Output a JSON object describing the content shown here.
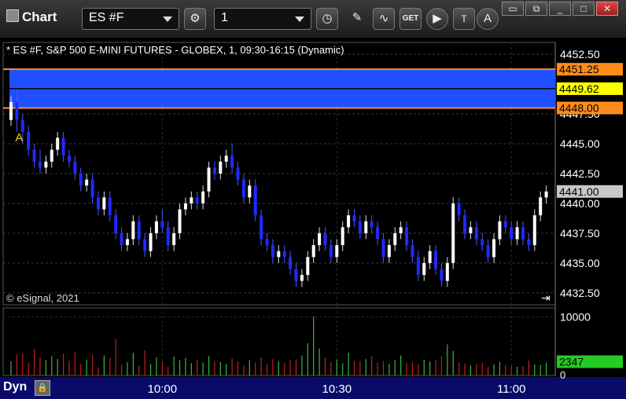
{
  "window": {
    "title": "Chart"
  },
  "toolbar": {
    "symbol": "ES #F",
    "interval": "1"
  },
  "chart": {
    "header": "* ES #F, S&P 500 E-MINI FUTURES - GLOBEX, 1, 09:30-16:15 (Dynamic)",
    "copyright": "© eSignal, 2021",
    "marker": "A",
    "price_labels": [
      "4452.50",
      "4447.50",
      "4445.00",
      "4442.50",
      "4440.00",
      "4437.50",
      "4435.00",
      "4432.50"
    ],
    "volume_labels": [
      "10000",
      "0"
    ],
    "time_labels": [
      "10:00",
      "10:30",
      "11:00"
    ],
    "tags": {
      "upper_band": "4451.25",
      "last": "4449.62",
      "lower_band": "4448.00",
      "cursor": "4441.00",
      "volume": "2347"
    },
    "footer": "Dyn"
  },
  "colors": {
    "band": "#1f50ff",
    "band_border": "#ff8a3a",
    "up_candle": "#ffffff",
    "down_candle": "#1f2aff",
    "vol_up": "#3cb83c",
    "vol_down": "#c02020",
    "last_tag": "#ffff00",
    "band_tag": "#ff8c1a",
    "volume_tag": "#22cc22"
  },
  "chart_data": {
    "type": "candlestick",
    "y_range": [
      4431.5,
      4453.5
    ],
    "volume_range": [
      0,
      11000
    ],
    "bars": [
      [
        4447.0,
        4448.5,
        4449.0,
        4446.5
      ],
      [
        4448.5,
        4447.0,
        4449.5,
        4446.0
      ],
      [
        4447.0,
        4446.0,
        4447.5,
        4445.0
      ],
      [
        4446.0,
        4444.5,
        4446.5,
        4444.0
      ],
      [
        4444.5,
        4443.5,
        4445.0,
        4443.0
      ],
      [
        4443.5,
        4443.0,
        4444.5,
        4442.5
      ],
      [
        4443.0,
        4443.5,
        4444.0,
        4442.5
      ],
      [
        4443.5,
        4444.5,
        4445.0,
        4443.0
      ],
      [
        4444.5,
        4445.5,
        4446.0,
        4444.0
      ],
      [
        4445.5,
        4444.0,
        4446.0,
        4443.5
      ],
      [
        4444.0,
        4443.5,
        4444.5,
        4443.0
      ],
      [
        4443.5,
        4442.5,
        4444.0,
        4442.0
      ],
      [
        4442.5,
        4441.5,
        4443.0,
        4441.0
      ],
      [
        4441.5,
        4442.0,
        4442.5,
        4441.0
      ],
      [
        4442.0,
        4440.5,
        4442.5,
        4440.0
      ],
      [
        4440.5,
        4439.5,
        4441.0,
        4439.0
      ],
      [
        4439.5,
        4440.5,
        4441.0,
        4439.0
      ],
      [
        4440.5,
        4439.0,
        4441.0,
        4438.5
      ],
      [
        4439.0,
        4437.5,
        4439.5,
        4437.0
      ],
      [
        4437.5,
        4436.5,
        4438.0,
        4436.0
      ],
      [
        4436.5,
        4437.0,
        4437.5,
        4436.0
      ],
      [
        4437.0,
        4438.5,
        4439.0,
        4436.5
      ],
      [
        4438.5,
        4437.0,
        4439.0,
        4436.5
      ],
      [
        4437.0,
        4436.0,
        4437.5,
        4435.5
      ],
      [
        4436.0,
        4437.5,
        4438.0,
        4435.5
      ],
      [
        4437.5,
        4438.5,
        4439.0,
        4437.0
      ],
      [
        4438.5,
        4438.0,
        4439.5,
        4437.5
      ],
      [
        4438.0,
        4436.5,
        4438.5,
        4436.0
      ],
      [
        4436.5,
        4437.5,
        4438.0,
        4436.0
      ],
      [
        4437.5,
        4439.5,
        4440.0,
        4437.0
      ],
      [
        4439.5,
        4440.0,
        4440.5,
        4439.0
      ],
      [
        4440.0,
        4440.5,
        4441.0,
        4439.5
      ],
      [
        4440.5,
        4440.0,
        4441.0,
        4439.5
      ],
      [
        4440.0,
        4441.0,
        4441.5,
        4439.5
      ],
      [
        4441.0,
        4443.0,
        4443.5,
        4440.5
      ],
      [
        4443.0,
        4442.5,
        4443.5,
        4442.0
      ],
      [
        4442.5,
        4443.5,
        4444.0,
        4442.0
      ],
      [
        4443.5,
        4444.0,
        4444.5,
        4443.0
      ],
      [
        4444.0,
        4443.0,
        4445.0,
        4442.5
      ],
      [
        4443.0,
        4442.0,
        4443.5,
        4441.5
      ],
      [
        4442.0,
        4440.5,
        4442.5,
        4440.0
      ],
      [
        4440.5,
        4441.5,
        4442.0,
        4440.0
      ],
      [
        4441.5,
        4439.0,
        4442.0,
        4438.5
      ],
      [
        4439.0,
        4437.0,
        4439.5,
        4436.5
      ],
      [
        4437.0,
        4436.5,
        4437.5,
        4436.0
      ],
      [
        4436.5,
        4435.5,
        4437.0,
        4435.0
      ],
      [
        4435.5,
        4436.0,
        4436.5,
        4435.0
      ],
      [
        4436.0,
        4435.5,
        4436.5,
        4435.0
      ],
      [
        4435.5,
        4434.5,
        4436.0,
        4434.0
      ],
      [
        4434.5,
        4433.5,
        4435.0,
        4433.0
      ],
      [
        4433.5,
        4434.0,
        4434.5,
        4433.0
      ],
      [
        4434.0,
        4435.5,
        4436.0,
        4433.5
      ],
      [
        4435.5,
        4436.5,
        4437.0,
        4435.0
      ],
      [
        4436.5,
        4437.5,
        4438.0,
        4436.0
      ],
      [
        4437.5,
        4436.5,
        4438.0,
        4436.0
      ],
      [
        4436.5,
        4435.5,
        4437.0,
        4435.0
      ],
      [
        4435.5,
        4436.5,
        4437.0,
        4435.0
      ],
      [
        4436.5,
        4438.0,
        4438.5,
        4436.0
      ],
      [
        4438.0,
        4439.0,
        4439.5,
        4437.5
      ],
      [
        4439.0,
        4438.5,
        4439.5,
        4438.0
      ],
      [
        4438.5,
        4437.5,
        4439.0,
        4437.0
      ],
      [
        4437.5,
        4438.5,
        4439.0,
        4437.0
      ],
      [
        4438.5,
        4438.0,
        4439.0,
        4437.5
      ],
      [
        4438.0,
        4437.0,
        4438.5,
        4436.5
      ],
      [
        4437.0,
        4435.5,
        4437.5,
        4435.0
      ],
      [
        4435.5,
        4436.5,
        4437.0,
        4435.0
      ],
      [
        4436.5,
        4437.5,
        4438.0,
        4436.0
      ],
      [
        4437.5,
        4438.0,
        4438.5,
        4437.0
      ],
      [
        4438.0,
        4436.5,
        4438.5,
        4436.0
      ],
      [
        4436.5,
        4435.5,
        4437.0,
        4435.0
      ],
      [
        4435.5,
        4434.0,
        4436.0,
        4433.5
      ],
      [
        4434.0,
        4435.0,
        4435.5,
        4433.5
      ],
      [
        4435.0,
        4436.0,
        4436.5,
        4434.5
      ],
      [
        4436.0,
        4434.5,
        4436.5,
        4434.0
      ],
      [
        4434.5,
        4433.5,
        4435.0,
        4433.0
      ],
      [
        4433.5,
        4435.0,
        4435.5,
        4433.0
      ],
      [
        4435.0,
        4440.0,
        4440.5,
        4434.5
      ],
      [
        4440.0,
        4439.0,
        4440.5,
        4438.5
      ],
      [
        4439.0,
        4437.5,
        4439.5,
        4437.0
      ],
      [
        4437.5,
        4438.0,
        4438.5,
        4437.0
      ],
      [
        4438.0,
        4437.0,
        4438.5,
        4436.5
      ],
      [
        4437.0,
        4436.5,
        4437.5,
        4436.0
      ],
      [
        4436.5,
        4435.5,
        4437.0,
        4435.0
      ],
      [
        4435.5,
        4437.0,
        4437.5,
        4435.0
      ],
      [
        4437.0,
        4438.5,
        4439.0,
        4436.5
      ],
      [
        4438.5,
        4438.0,
        4439.0,
        4437.5
      ],
      [
        4438.0,
        4437.0,
        4438.5,
        4436.5
      ],
      [
        4437.0,
        4438.0,
        4438.5,
        4436.5
      ],
      [
        4438.0,
        4437.0,
        4438.5,
        4436.5
      ],
      [
        4437.0,
        4436.5,
        4437.5,
        4436.0
      ],
      [
        4436.5,
        4439.0,
        4439.5,
        4436.0
      ],
      [
        4439.0,
        4440.5,
        4441.0,
        4438.5
      ],
      [
        4440.5,
        4441.0,
        4441.5,
        4440.0
      ]
    ],
    "volume": [
      2400,
      3600,
      3800,
      2200,
      4500,
      3100,
      2600,
      3300,
      2800,
      3700,
      2500,
      4000,
      1900,
      2700,
      3500,
      1400,
      3400,
      2900,
      6200,
      1800,
      2300,
      3900,
      1700,
      4300,
      2000,
      3100,
      2400,
      1500,
      3200,
      2600,
      3000,
      2100,
      2700,
      2200,
      3300,
      2500,
      2300,
      2000,
      2900,
      2400,
      1700,
      2600,
      2200,
      3100,
      1900,
      2800,
      2400,
      2100,
      2600,
      2800,
      3400,
      5500,
      10100,
      4600,
      3100,
      2300,
      2700,
      2100,
      3900,
      2500,
      2400,
      2800,
      3300,
      2200,
      2500,
      2000,
      2600,
      3400,
      2100,
      2300,
      1900,
      2700,
      2400,
      2600,
      3300,
      5300,
      4200,
      2200,
      2000,
      1700,
      2000,
      2200,
      1500,
      1900,
      2300,
      1800,
      1700,
      1500,
      1600,
      2500,
      1900,
      1800,
      2200
    ]
  }
}
